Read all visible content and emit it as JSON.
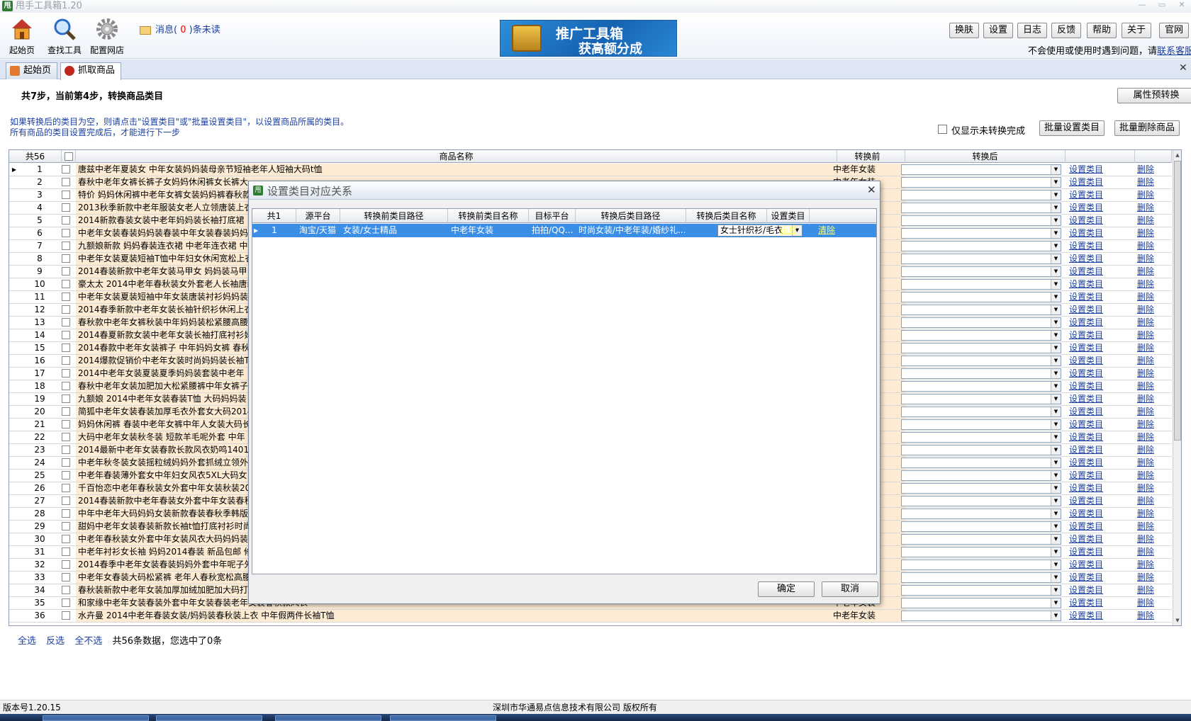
{
  "window": {
    "title": "甩手工具箱1.20"
  },
  "toolbar": {
    "home_label": "起始页",
    "find_label": "查找工具",
    "config_label": "配置网店",
    "msg_prefix": "消息(",
    "msg_count": "0",
    "msg_suffix": ")条未读"
  },
  "banner": {
    "line1": "推广工具箱",
    "line2": "获高额分成"
  },
  "top_buttons": [
    "换肤",
    "设置",
    "日志",
    "反馈",
    "帮助",
    "关于",
    "官网"
  ],
  "help_line": {
    "text": "不会使用或使用时遇到问题，请",
    "link": "联系客服"
  },
  "tabs": [
    {
      "label": "起始页"
    },
    {
      "label": "抓取商品"
    }
  ],
  "page": {
    "step": "共7步，当前第4步，转换商品类目",
    "preview_button": "属性预转换",
    "hint1": "如果转换后的类目为空，则请点击\"设置类目\"或\"批量设置类目\"，以设置商品所属的类目。",
    "hint2": "所有商品的类目设置完成后，才能进行下一步",
    "only_untrans_label": "仅显示未转换完成",
    "batch_set_button": "批量设置类目",
    "batch_delete_button": "批量删除商品"
  },
  "grid": {
    "count_header": "共56",
    "columns": [
      "商品名称",
      "转换前",
      "转换后"
    ],
    "set_link": "设置类目",
    "delete_link": "删除",
    "before_value": "中老年女装",
    "rows": [
      "唐兹中老年夏装女 中年女装妈妈装母亲节短袖老年人短袖大码t恤",
      "春秋中老年女裤长裤子女妈妈休闲裤女长裤大",
      "特价 妈妈休闲裤中老年女裤女装妈妈裤春秋款",
      "2013秋季新款中老年服装女老人立领唐装上衣",
      "2014新款春装女装中老年妈妈装长袖打底裙",
      "中老年女装春装妈妈装春装中年女装春装妈妈",
      "九额娘新款 妈妈春装连衣裙 中老年连衣裙 中",
      "中老年女装夏装短袖T恤中年妇女休闲宽松上衣",
      "2014春装新款中老年女装马甲女 妈妈装马甲",
      "豪太太 2014中老年春秋装女外套老人长袖唐装",
      "中老年女装夏装短袖中年女装唐装衬衫妈妈装",
      "2014春季新款中老年女装长袖针织衫休闲上衣",
      "春秋款中老年女裤秋装中年妈妈装松紧腰高腰",
      "2014春夏新款女装中老年女装长袖打底衬衫妈妈",
      "2014春款中老年女装裤子 中年妈妈女裤 春秋",
      "2014爆款促销价中老年女装时尚妈妈装长袖T恤",
      "2014中老年女装夏装夏季妈妈装套装中老年",
      "春秋中老年女装加肥加大松紧腰裤中年女裤子",
      "九额娘 2014中老年女装春装T恤 大码妈妈装",
      "简狐中老年女装春装加厚毛衣外套女大码2014",
      "妈妈休闲裤 春装中老年女裤中年人女装大码长",
      "大码中老年女装秋冬装 短款羊毛呢外套 中年",
      "2014最新中老年女装春款长款风衣奶鸣14012",
      "中老年秋冬装女装摇粒绒妈妈外套抓绒立领外",
      "中老年春装薄外套女中年妇女风衣5XL大码女",
      "千百怡恋中老年春秋装女外套中年女装秋装2014",
      "2014春装新款中老年春装女外套中年女装春秋",
      "中年中老年大码妈妈女装新款春装春秋季韩版",
      "甜妈中老年女装春装新款长袖t恤打底衬衫时尚",
      "中老年春秋装女外套中年女装风衣大码妈妈装",
      "中老年衬衫女长袖 妈妈2014春装 新品包邮 修身",
      "2014春季中老年女装春装妈妈外套中年呢子外套",
      "中老年女春装大码松紧裤 老年人春秋宽松高腰",
      "春秋装新款中老年女装加厚加绒加肥加大码打底",
      "和家缘中老年女装春装外套中年女装春装老年女装春秋款风衣",
      "水卉曼 2014中老年春装女装/妈妈装春秋装上衣 中年假两件长袖T恤"
    ]
  },
  "bottom": {
    "select_all": "全选",
    "invert": "反选",
    "select_none": "全不选",
    "summary": "共56条数据，您选中了0条"
  },
  "status": {
    "version": "版本号1.20.15",
    "copyright": "深圳市华通易点信息技术有限公司 版权所有"
  },
  "dialog": {
    "title": "设置类目对应关系",
    "columns": [
      "共1",
      "源平台",
      "转换前类目路径",
      "转换前类目名称",
      "目标平台",
      "转换后类目路径",
      "转换后类目名称",
      "设置类目"
    ],
    "row": {
      "num": "1",
      "src": "淘宝/天猫",
      "before_path": "女装/女士精品",
      "before_name": "中老年女装",
      "target": "拍拍/QQ...",
      "after_path": "时尚女装/中老年装/婚纱礼...",
      "after_name": "女士针织衫/毛衣",
      "set": "设置",
      "clear": "清除"
    },
    "ok": "确定",
    "cancel": "取消"
  }
}
